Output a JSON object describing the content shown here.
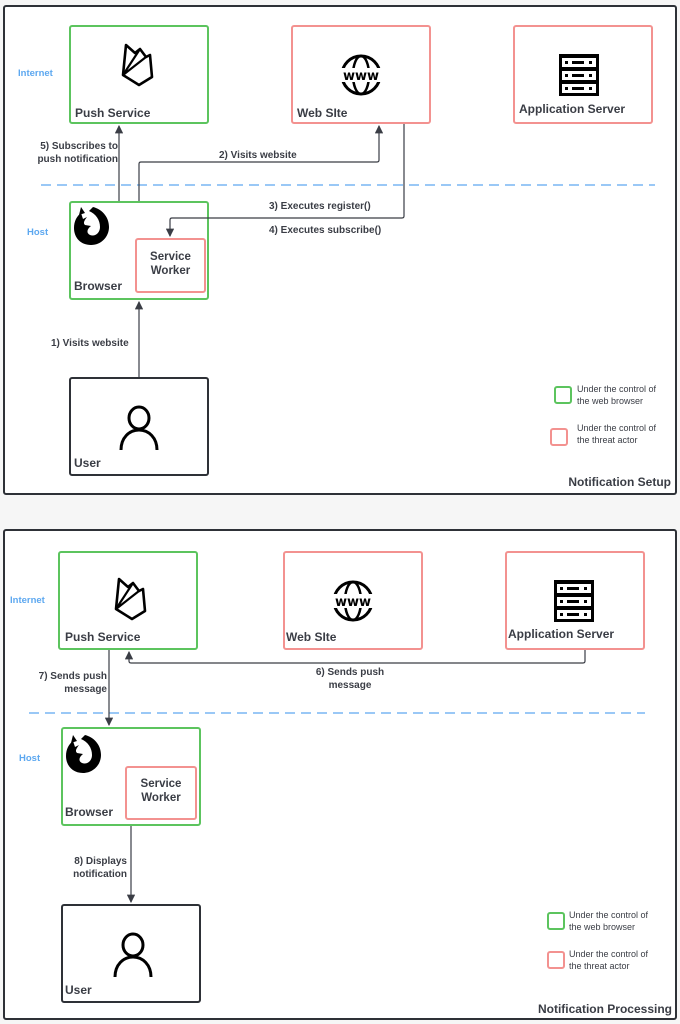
{
  "colors": {
    "browser_control": "#5cc45e",
    "threat_actor_control": "#f39290",
    "zone_label": "#5da8f0",
    "boundary_line": "#5da8f0",
    "text": "#3a3d45",
    "frame": "#2e3137"
  },
  "setup": {
    "title": "Notification Setup",
    "zones": {
      "internet": "Internet",
      "host": "Host"
    },
    "nodes": {
      "push_service": {
        "label": "Push Service",
        "icon": "firebase-icon"
      },
      "web_site": {
        "label": "Web SIte",
        "icon": "www-globe-icon"
      },
      "app_server": {
        "label": "Application Server",
        "icon": "server-rack-icon"
      },
      "browser": {
        "label": "Browser",
        "icon": "firefox-icon"
      },
      "service_worker": {
        "line1": "Service",
        "line2": "Worker"
      },
      "user": {
        "label": "User",
        "icon": "user-icon"
      }
    },
    "edges": {
      "e1": "1) Visits website",
      "e2": "2) Visits website",
      "e3": "3) Executes register()",
      "e4": "4) Executes subscribe()",
      "e5_line1": "5) Subscribes to",
      "e5_line2": "push notification"
    },
    "legend": {
      "green_line1": "Under the control of",
      "green_line2": "the web browser",
      "red_line1": "Under the control of",
      "red_line2": "the threat actor"
    }
  },
  "processing": {
    "title": "Notification Processing",
    "zones": {
      "internet": "Internet",
      "host": "Host"
    },
    "nodes": {
      "push_service": {
        "label": "Push Service",
        "icon": "firebase-icon"
      },
      "web_site": {
        "label": "Web SIte",
        "icon": "www-globe-icon"
      },
      "app_server": {
        "label": "Application Server",
        "icon": "server-rack-icon"
      },
      "browser": {
        "label": "Browser",
        "icon": "firefox-icon"
      },
      "service_worker": {
        "line1": "Service",
        "line2": "Worker"
      },
      "user": {
        "label": "User",
        "icon": "user-icon"
      }
    },
    "edges": {
      "e6_line1": "6) Sends push",
      "e6_line2": "message",
      "e7_line1": "7) Sends push",
      "e7_line2": "message",
      "e8_line1": "8) Displays",
      "e8_line2": "notification"
    },
    "legend": {
      "green_line1": "Under the control of",
      "green_line2": "the web browser",
      "red_line1": "Under the control of",
      "red_line2": "the threat actor"
    }
  }
}
